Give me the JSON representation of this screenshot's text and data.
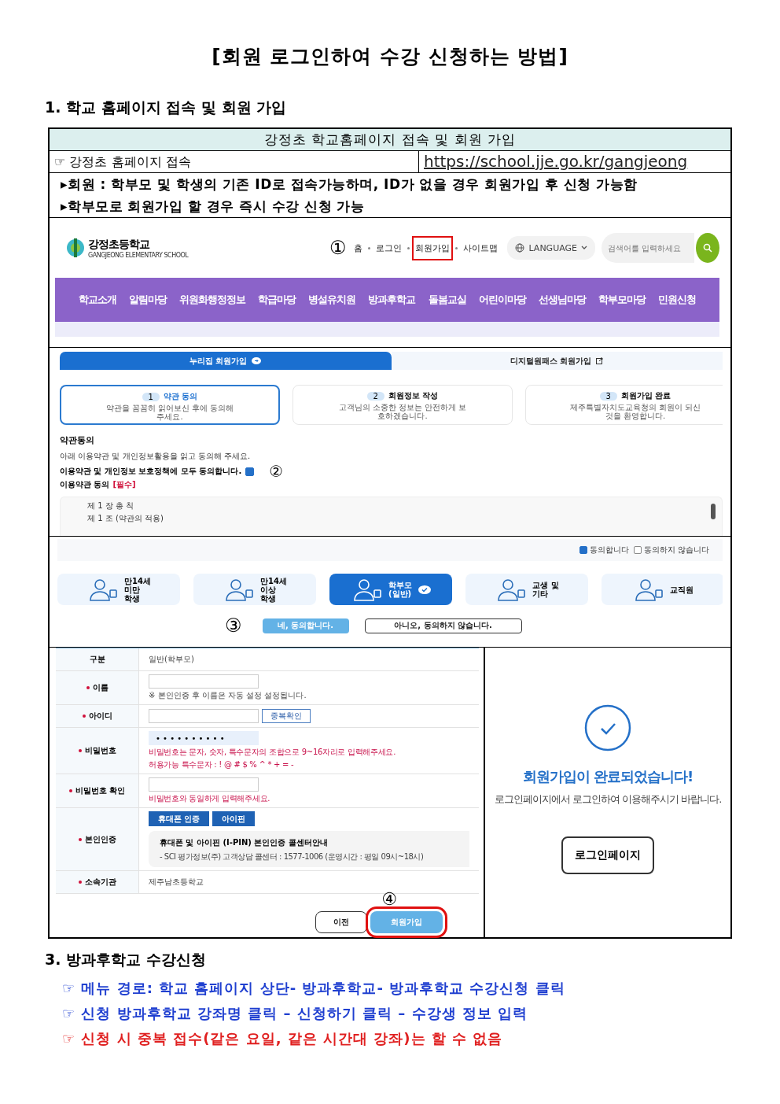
{
  "title": "[회원 로그인하여 수강 신청하는 방법]",
  "section1": {
    "heading": "1. 학교 홈페이지 접속 및 회원 가입",
    "table": {
      "header": "강정초 학교홈페이지 접속 및 회원 가입",
      "site_label": "☞ 강정초 홈페이지 접속",
      "url": "https://school.jje.go.kr/gangjeong",
      "notes": [
        "▸회원 : 학부모 및 학생의 기존 ID로 접속가능하며, ID가 없을 경우 회원가입 후 신청 가능함",
        "▸학부모로 회원가입 할 경우 즉시 수강 신청 가능"
      ]
    },
    "homepage": {
      "school_name": "강정초등학교",
      "school_subtitle": "GANGJEONG ELEMENTARY SCHOOL",
      "step": "①",
      "links": [
        {
          "label": "홈",
          "highlighted": false
        },
        {
          "label": "로그인",
          "highlighted": false
        },
        {
          "label": "회원가입",
          "highlighted": true
        },
        {
          "label": "사이트맵",
          "highlighted": false
        }
      ],
      "language": "LANGUAGE",
      "search": {
        "placeholder": "검색어를 입력하세요"
      },
      "menu": [
        "학교소개",
        "알림마당",
        "위원화행정정보",
        "학급마당",
        "병설유치원",
        "방과후학교",
        "돌봄교실",
        "어린이마당",
        "선생님마당",
        "학부모마당",
        "민원신청"
      ]
    },
    "agreement": {
      "tabs": [
        {
          "label": "누리집 회원가입",
          "selected": true
        },
        {
          "label": "디지털원패스 회원가입",
          "selected": false
        }
      ],
      "steps": [
        {
          "number": "1",
          "title": "약관 동의",
          "description": "약관을 꼼꼼히 읽어보신 후에 동의해주세요.",
          "selected": true
        },
        {
          "number": "2",
          "title": "회원정보 작성",
          "description": "고객님의 소중한 정보는 안전하게 보호하겠습니다.",
          "selected": false
        },
        {
          "number": "3",
          "title": "회원가입 완료",
          "description": "제주특별자치도교육청의 회원이 되신것을 환영합니다.",
          "selected": false
        }
      ],
      "heading": "약관동의",
      "instruction": "아래 이용약관 및 개인정보활용을 읽고 동의해 주세요.",
      "agree_all": {
        "label": "이용약관 및 개인정보 보호정책에 모두 동의합니다.",
        "checked": true
      },
      "step": "②",
      "terms_title": "이용약관 동의",
      "required_tag": "[필수]",
      "terms_lines": [
        "제 1 장 총 칙",
        "제 1 조 (약관의 적용)"
      ]
    },
    "member_type": {
      "options": [
        {
          "label": "동의합니다",
          "checked": true
        },
        {
          "label": "동의하지 않습니다",
          "checked": false
        }
      ],
      "types": [
        {
          "lines": [
            "만14세",
            "미만",
            "학생"
          ],
          "selected": false
        },
        {
          "lines": [
            "만14세",
            "이상",
            "학생"
          ],
          "selected": false
        },
        {
          "lines": [
            "학부모",
            "(일반)"
          ],
          "selected": true
        },
        {
          "lines": [
            "교생 및",
            "기타"
          ],
          "selected": false
        },
        {
          "lines": [
            "교직원"
          ],
          "selected": false
        }
      ],
      "step": "③",
      "buttons": [
        {
          "label": "네, 동의합니다.",
          "kind": "primary"
        },
        {
          "label": "아니오, 동의하지 않습니다.",
          "kind": "outline"
        }
      ]
    },
    "form": {
      "rows": [
        {
          "label": "구분",
          "required": false,
          "kind": "text",
          "value": "일반(학부모)"
        },
        {
          "label": "이름",
          "required": true,
          "kind": "input",
          "note": "※ 본인인증 후 이름은 자동 설정 설정됩니다."
        },
        {
          "label": "아이디",
          "required": true,
          "kind": "input",
          "button": "중복확인"
        },
        {
          "label": "비밀번호",
          "required": true,
          "kind": "password",
          "value": "• • • • • • • • • •",
          "warnings": [
            "비밀번호는 문자, 숫자, 특수문자의 조합으로 9~16자리로 입력해주세요.",
            "허용가능 특수문자 : ! @ # $ % ^ * + = -"
          ]
        },
        {
          "label": "비밀번호 확인",
          "required": true,
          "kind": "input",
          "warnings": [
            "비밀번호와 동일하게 입력해주세요."
          ]
        },
        {
          "label": "본인인증",
          "required": true,
          "kind": "auth",
          "buttons": [
            "휴대폰 인증",
            "아이핀"
          ],
          "info_title": "휴대폰 및 아이핀 (I-PIN) 본인인증 콜센터안내",
          "info_text": "- SCI 평가정보(주) 고객상담 콜센터 : 1577-1006 (운영시간 : 평일 09시~18시)"
        },
        {
          "label": "소속기관",
          "required": true,
          "kind": "text",
          "value": "제주남초등학교"
        }
      ],
      "step": "④",
      "buttons": [
        {
          "label": "이전",
          "kind": "outline",
          "highlighted": false
        },
        {
          "label": "회원가입",
          "kind": "primary",
          "highlighted": true
        }
      ]
    },
    "complete": {
      "title": "회원가입이 완료되었습니다!",
      "message": "로그인페이지에서 로그인하여 이용해주시기 바랍니다.",
      "button": "로그인페이지"
    }
  },
  "section3": {
    "heading": "3. 방과후학교 수강신청",
    "items": [
      {
        "text": "☞ 메뉴 경로: 학교 홈페이지 상단- 방과후학교- 방과후학교 수강신청 클릭",
        "color": "#1f3fd0"
      },
      {
        "text": "☞ 신청 방과후학교 강좌명 클릭 – 신청하기 클릭 – 수강생 정보 입력",
        "color": "#1f3fd0"
      },
      {
        "text": "☞ 신청 시 중복 접수(같은 요일, 같은 시간대 강좌)는 할 수 없음",
        "color": "#e02020"
      }
    ]
  }
}
